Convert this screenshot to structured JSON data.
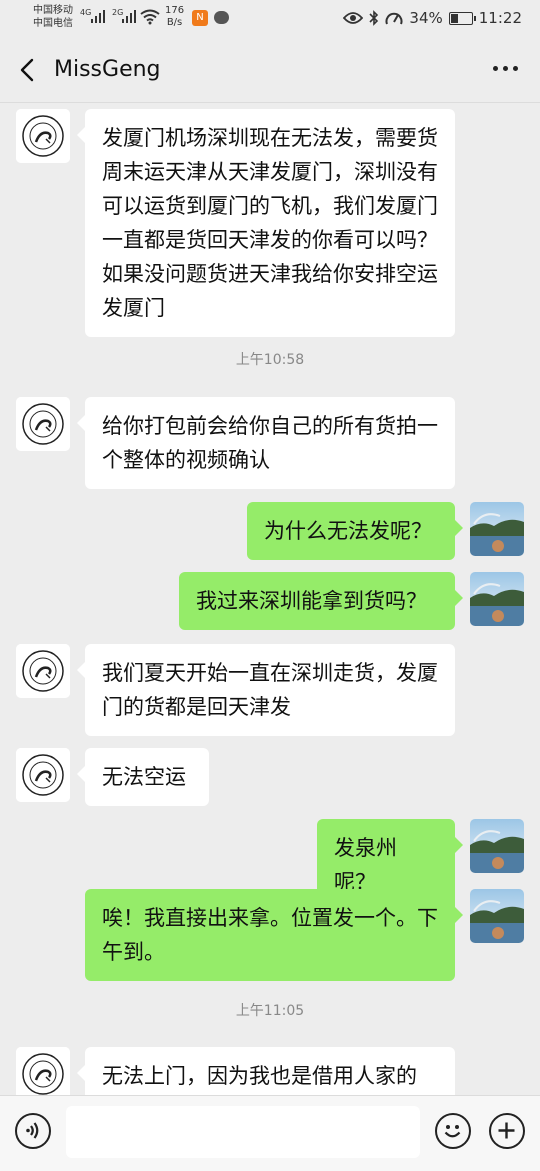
{
  "status_bar": {
    "carrier1": "中国移动",
    "carrier2": "中国电信",
    "net1": "4G",
    "net2": "2G",
    "speed_value": "176",
    "speed_unit": "B/s",
    "battery": "34%",
    "battery_level": 0.34,
    "time": "11:22"
  },
  "header": {
    "title": "MissGeng"
  },
  "messages": [
    {
      "side": "left",
      "text": "发厦门机场深圳现在无法发，需要货周末运天津从天津发厦门，深圳没有可以运货到厦门的飞机，我们发厦门一直都是货回天津发的你看可以吗？如果没问题货进天津我给你安排空运发厦门"
    },
    {
      "time": "上午10:58"
    },
    {
      "side": "left",
      "text": "给你打包前会给你自己的所有货拍一个整体的视频确认"
    },
    {
      "side": "right",
      "text": "为什么无法发呢？"
    },
    {
      "side": "right",
      "text": "我过来深圳能拿到货吗？"
    },
    {
      "side": "left",
      "text": "我们夏天开始一直在深圳走货，发厦门的货都是回天津发"
    },
    {
      "side": "left",
      "text": "无法空运"
    },
    {
      "side": "right",
      "text": "发泉州呢？"
    },
    {
      "side": "right",
      "text": "唉！我直接出来拿。位置发一个。下午到。"
    },
    {
      "time": "上午11:05"
    },
    {
      "side": "left",
      "text": "无法上门，因为我也是借用人家的"
    }
  ],
  "avatars": {
    "contact_logo_text": "BODEWARUCIA MissGeng",
    "self_icon": "landscape-photo-icon"
  },
  "colors": {
    "background": "#ededed",
    "bubble_left": "#ffffff",
    "bubble_right": "#95ec69"
  },
  "bottom_bar": {
    "voice_icon": "voice-icon",
    "emoji_icon": "emoji-icon",
    "plus_icon": "plus-icon"
  }
}
